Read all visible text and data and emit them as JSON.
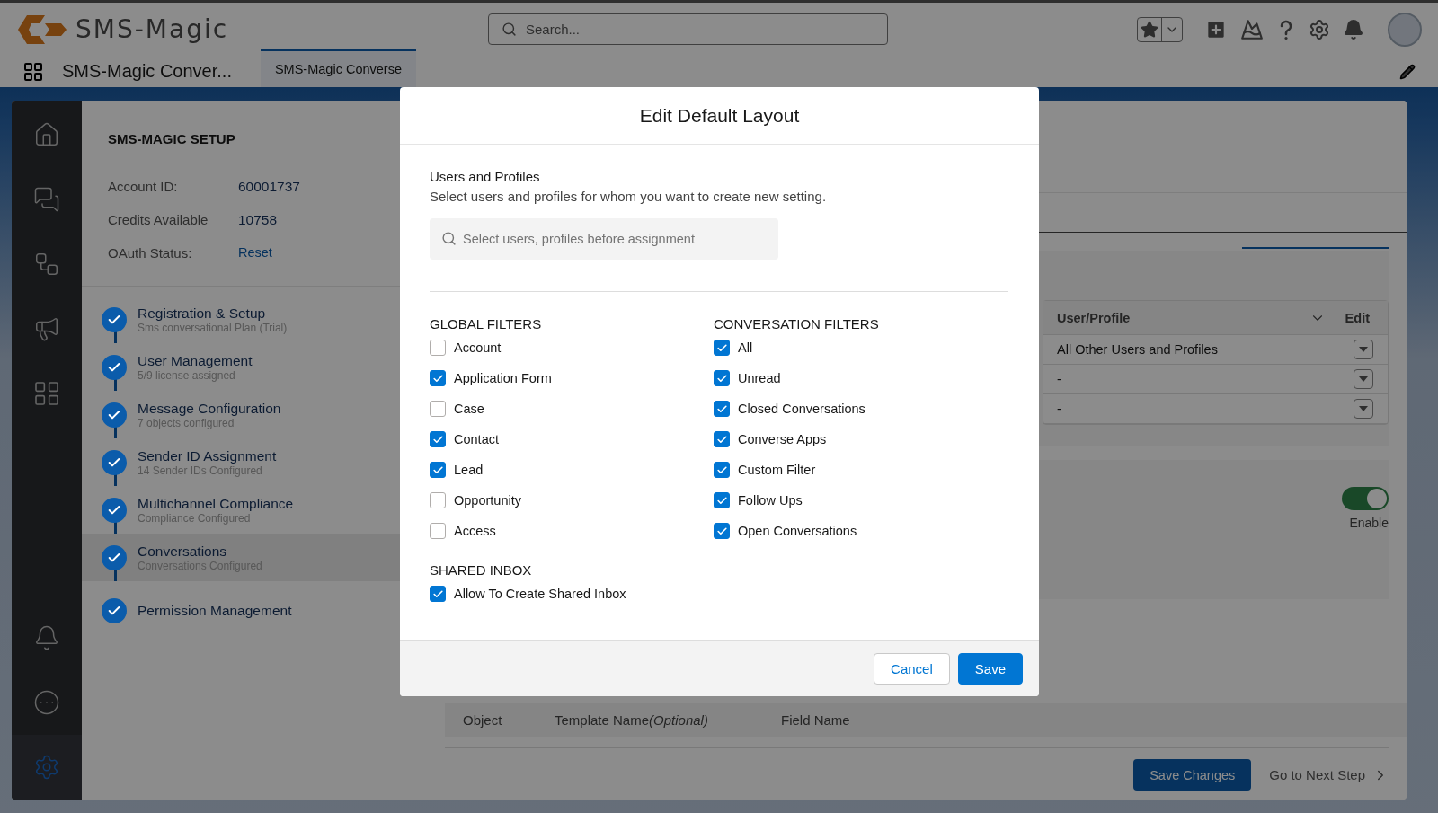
{
  "header": {
    "logo_text": "SMS-Magic",
    "search": {
      "placeholder": "Search..."
    }
  },
  "nav": {
    "app_name": "SMS-Magic Conver...",
    "tabs": [
      {
        "label": "SMS-Magic Converse",
        "selected": true
      }
    ]
  },
  "rail": {
    "items": [
      {
        "selected": false
      },
      {
        "selected": false
      },
      {
        "selected": false
      },
      {
        "selected": false
      },
      {
        "selected": false
      },
      {
        "selected": false
      },
      {
        "selected": false
      },
      {
        "selected": true
      }
    ]
  },
  "setup": {
    "title": "SMS-MAGIC SETUP",
    "info": [
      {
        "label": "Account ID:",
        "value": "60001737",
        "kind": "text"
      },
      {
        "label": "Credits Available",
        "value": "10758",
        "kind": "text"
      },
      {
        "label": "OAuth Status:",
        "value": "Reset",
        "kind": "link"
      }
    ],
    "steps": [
      {
        "title": "Registration & Setup",
        "subtitle": "Sms conversational Plan (Trial)",
        "done": true,
        "selected": false
      },
      {
        "title": "User Management",
        "subtitle": "5/9 license assigned",
        "done": true,
        "selected": false
      },
      {
        "title": "Message Configuration",
        "subtitle": "7 objects configured",
        "done": true,
        "selected": false
      },
      {
        "title": "Sender ID Assignment",
        "subtitle": "14 Sender IDs Configured",
        "done": true,
        "selected": false
      },
      {
        "title": "Multichannel Compliance",
        "subtitle": "Compliance Configured",
        "done": true,
        "selected": false
      },
      {
        "title": "Conversations",
        "subtitle": "Conversations Configured",
        "done": true,
        "selected": true
      },
      {
        "title": "Permission Management",
        "done": true,
        "selected": false
      }
    ]
  },
  "main": {
    "layout_table": {
      "columns": [
        "User/Profile",
        "Edit"
      ],
      "rows": [
        {
          "user_profile": "All Other Users and Profiles"
        },
        {
          "user_profile": "-"
        },
        {
          "user_profile": "-"
        }
      ]
    },
    "toggle": {
      "on": true,
      "label": "Enable"
    },
    "fields_table": {
      "columns": [
        {
          "label": "Object"
        },
        {
          "label": "Template Name",
          "note": "(Optional)"
        },
        {
          "label": "Field Name"
        }
      ]
    },
    "save_changes": "Save Changes",
    "next_step": "Go to Next Step"
  },
  "modal": {
    "title": "Edit Default Layout",
    "section_title": "Users and Profiles",
    "description": "Select users and profiles for whom you want to create new setting.",
    "search": {
      "placeholder": "Select users, profiles before assignment"
    },
    "groups": [
      {
        "title": "GLOBAL FILTERS",
        "items": [
          {
            "label": "Account",
            "checked": false
          },
          {
            "label": "Application Form",
            "checked": true
          },
          {
            "label": "Case",
            "checked": false
          },
          {
            "label": "Contact",
            "checked": true
          },
          {
            "label": "Lead",
            "checked": true
          },
          {
            "label": "Opportunity",
            "checked": false
          },
          {
            "label": "Access",
            "checked": false
          }
        ]
      },
      {
        "title": "CONVERSATION FILTERS",
        "items": [
          {
            "label": "All",
            "checked": true
          },
          {
            "label": "Unread",
            "checked": true
          },
          {
            "label": "Closed Conversations",
            "checked": true
          },
          {
            "label": "Converse Apps",
            "checked": true
          },
          {
            "label": "Custom Filter",
            "checked": true
          },
          {
            "label": "Follow Ups",
            "checked": true
          },
          {
            "label": "Open Conversations",
            "checked": true
          }
        ]
      },
      {
        "title": "SHARED INBOX",
        "items": [
          {
            "label": "Allow To Create Shared Inbox",
            "checked": true
          }
        ]
      }
    ],
    "buttons": [
      {
        "label": "Cancel",
        "kind": "neutral"
      },
      {
        "label": "Save",
        "kind": "brand"
      }
    ]
  }
}
